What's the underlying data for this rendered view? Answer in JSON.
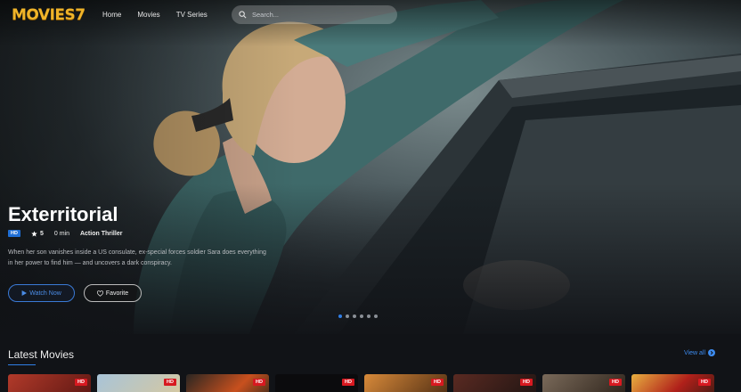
{
  "header": {
    "logo": "MOVIES7",
    "nav": [
      "Home",
      "Movies",
      "TV Series"
    ],
    "search_placeholder": "Search..."
  },
  "hero": {
    "title": "Exterritorial",
    "quality": "HD",
    "rating": "5",
    "duration": "0 min",
    "genres": "Action Thriller",
    "description": "When her son vanishes inside a US consulate, ex-special forces soldier Sara does everything in her power to find him — and uncovers a dark conspiracy.",
    "watch_label": "Watch Now",
    "favorite_label": "Favorite",
    "slides_count": 6,
    "active_slide": 1
  },
  "latest": {
    "title": "Latest Movies",
    "view_all": "View all",
    "posters": [
      {
        "badge": "HD",
        "color": "#8a2a22"
      },
      {
        "badge": "HD",
        "color": "#c7b79a"
      },
      {
        "badge": "HD",
        "color": "#5a3b2a"
      },
      {
        "badge": "HD",
        "color": "#0c0c0e"
      },
      {
        "badge": "HD",
        "color": "#7a4a1e"
      },
      {
        "badge": "HD",
        "color": "#3a2420"
      },
      {
        "badge": "HD",
        "color": "#4b3a2c"
      },
      {
        "badge": "HD",
        "color": "#9a2a1a"
      }
    ]
  },
  "colors": {
    "accent": "#2f7ee6",
    "logo": "#f0b429",
    "badge_red": "#d71920"
  },
  "icons": [
    "search-icon",
    "star-icon",
    "play-icon",
    "heart-icon",
    "arrow-right-circle-icon"
  ]
}
